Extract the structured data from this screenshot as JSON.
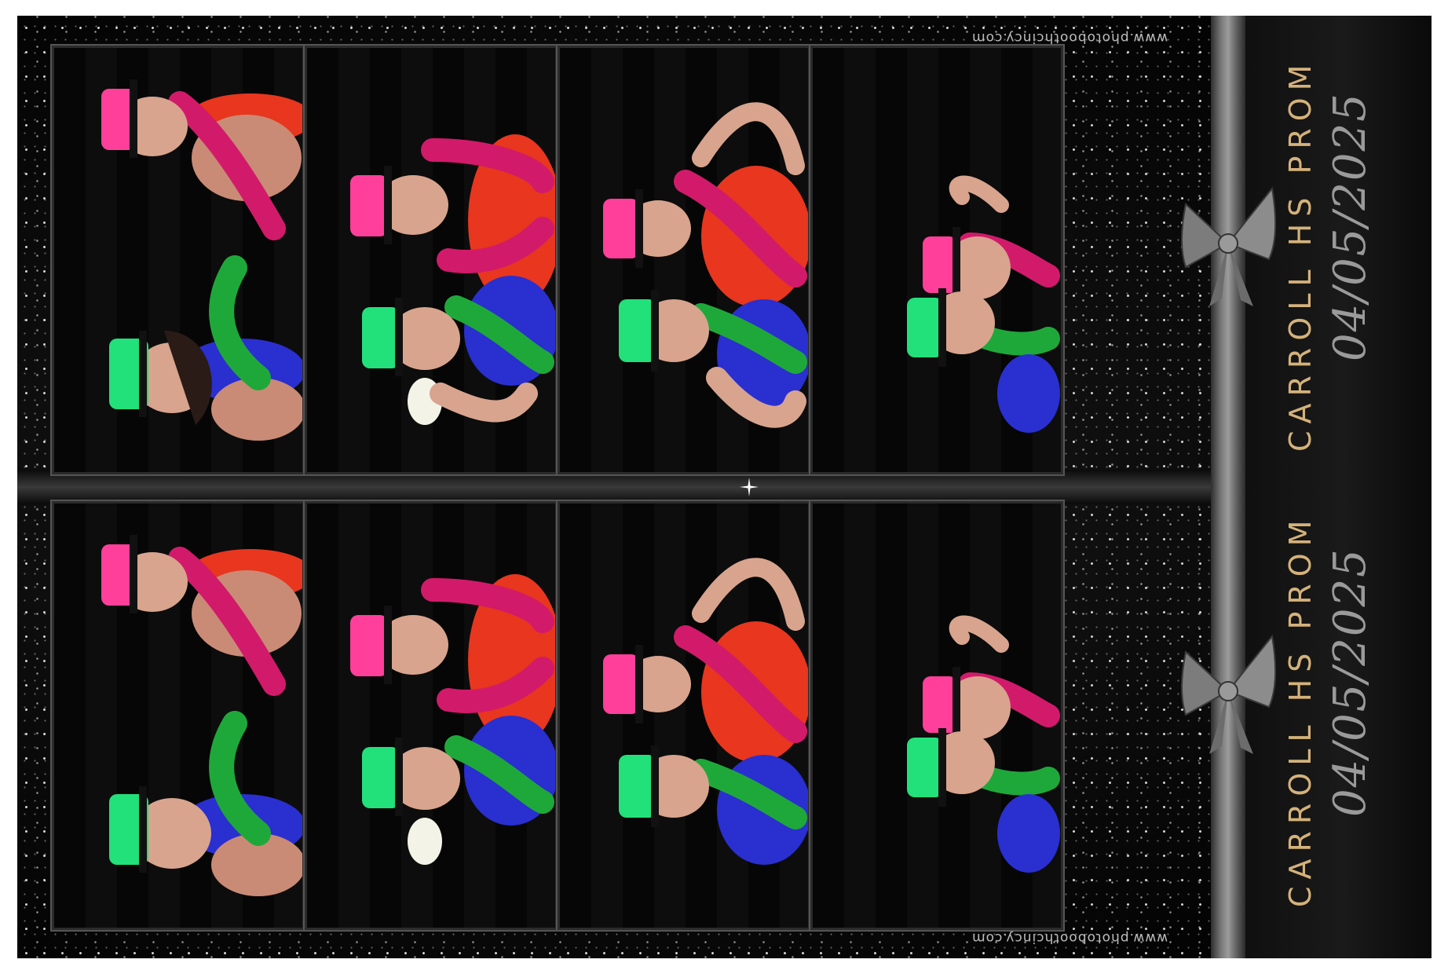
{
  "strips": [
    {
      "title": "CARROLL HS PROM",
      "date": "04/05/2025",
      "url": "www.photoboothcincy.com"
    },
    {
      "title": "CARROLL HS PROM",
      "date": "04/05/2025",
      "url": "www.photoboothcincy.com"
    }
  ],
  "colors": {
    "title_gold": "#d4b27a",
    "date_gray": "#9a9a9a",
    "hat_pink": "#ff3f9a",
    "hat_green": "#22e07a",
    "dress_red": "#e8361f",
    "dress_blue": "#2a2fd0",
    "boa_pink": "#d21a6a",
    "boa_green": "#1fa83a",
    "ribbon_gray": "#8a8a8a"
  }
}
